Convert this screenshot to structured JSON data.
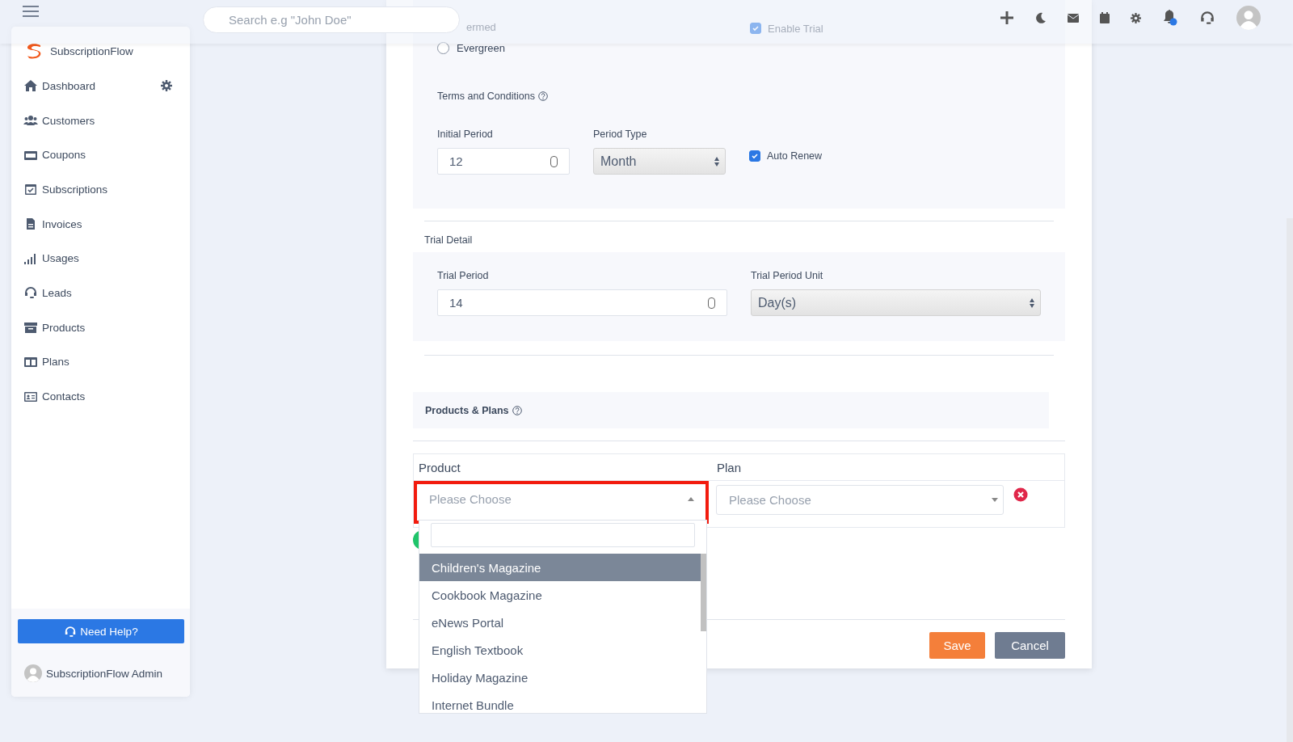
{
  "header": {
    "search": {
      "placeholder": "Search e.g \"John Doe\""
    }
  },
  "sidebar": {
    "brand": "SubscriptionFlow",
    "items": [
      {
        "label": "Dashboard",
        "selected": false
      },
      {
        "label": "Customers",
        "selected": false
      },
      {
        "label": "Coupons",
        "selected": false
      },
      {
        "label": "Subscriptions",
        "selected": false
      },
      {
        "label": "Invoices",
        "selected": false
      },
      {
        "label": "Usages",
        "selected": false
      },
      {
        "label": "Leads",
        "selected": false
      },
      {
        "label": "Products",
        "selected": false
      },
      {
        "label": "Plans",
        "selected": false
      },
      {
        "label": "Contacts",
        "selected": false
      }
    ],
    "help_button": "Need Help?",
    "user": "SubscriptionFlow Admin"
  },
  "form": {
    "term_partial": "ermed",
    "enable_trial": {
      "label": "Enable Trial",
      "checked": true
    },
    "evergreen": {
      "label": "Evergreen",
      "selected": false
    },
    "terms_title": "Terms and Conditions",
    "initial_period": {
      "label": "Initial Period",
      "value": "12"
    },
    "period_type": {
      "label": "Period Type",
      "value": "Month"
    },
    "auto_renew": {
      "label": "Auto Renew",
      "checked": true
    },
    "trial_title": "Trial Detail",
    "trial_period": {
      "label": "Trial Period",
      "value": "14"
    },
    "trial_period_unit": {
      "label": "Trial Period Unit",
      "value": "Day(s)"
    },
    "products_title": "Products & Plans",
    "columns": [
      "Product",
      "Plan"
    ],
    "product_select": {
      "placeholder": "Please Choose",
      "highlighted": true
    },
    "plan_select": {
      "placeholder": "Please Choose"
    },
    "options": [
      {
        "label": "Children's Magazine",
        "selected": true
      },
      {
        "label": "Cookbook Magazine",
        "selected": false
      },
      {
        "label": "eNews Portal",
        "selected": false
      },
      {
        "label": "English Textbook",
        "selected": false
      },
      {
        "label": "Holiday Magazine",
        "selected": false
      },
      {
        "label": "Internet Bundle",
        "selected": false
      }
    ],
    "buttons": {
      "save": "Save",
      "cancel": "Cancel"
    }
  }
}
